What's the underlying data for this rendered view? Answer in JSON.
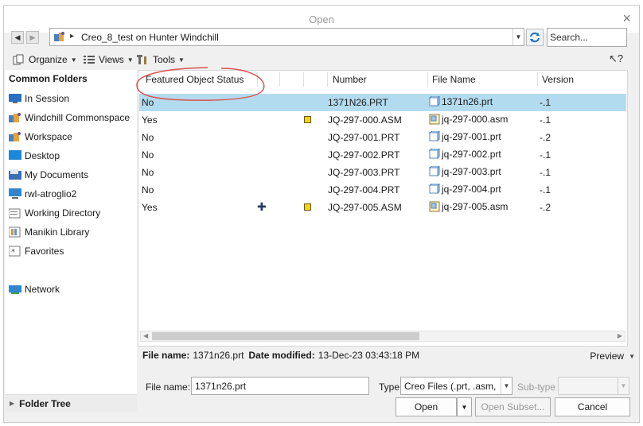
{
  "window": {
    "title": "Open",
    "close_glyph": "×"
  },
  "nav": {
    "back_icon": "back-arrow-icon",
    "forward_icon": "forward-arrow-icon"
  },
  "address": {
    "arrow": "▸",
    "path": "Creo_8_test on Hunter Windchill"
  },
  "search": {
    "placeholder": "Search..."
  },
  "toolbar": {
    "organize": "Organize",
    "views": "Views",
    "tools": "Tools",
    "help_glyph": "?"
  },
  "sidebar": {
    "header": "Common Folders",
    "items": [
      {
        "label": "In Session",
        "icon": "session-icon"
      },
      {
        "label": "Windchill Commonspace",
        "icon": "commonspace-icon"
      },
      {
        "label": "Workspace",
        "icon": "workspace-icon"
      },
      {
        "label": "Desktop",
        "icon": "desktop-icon"
      },
      {
        "label": "My Documents",
        "icon": "documents-icon"
      },
      {
        "label": "rwl-atroglio2",
        "icon": "computer-icon"
      },
      {
        "label": "Working Directory",
        "icon": "working-directory-icon"
      },
      {
        "label": "Manikin Library",
        "icon": "library-icon"
      },
      {
        "label": "Favorites",
        "icon": "favorites-icon"
      },
      {
        "label": "Network",
        "icon": "network-icon"
      }
    ],
    "tree_label": "Folder Tree"
  },
  "file_list": {
    "columns": [
      "Featured Object Status",
      "Number",
      "File Name",
      "Version"
    ],
    "rows": [
      {
        "status": "No",
        "number": "1371N26.PRT",
        "file_name": "1371n26.prt",
        "version": "-.1",
        "selected": true
      },
      {
        "status": "Yes",
        "number": "JQ-297-000.ASM",
        "file_name": "jq-297-000.asm",
        "version": "-.1"
      },
      {
        "status": "No",
        "number": "JQ-297-001.PRT",
        "file_name": "jq-297-001.prt",
        "version": "-.2"
      },
      {
        "status": "No",
        "number": "JQ-297-002.PRT",
        "file_name": "jq-297-002.prt",
        "version": "-.1"
      },
      {
        "status": "No",
        "number": "JQ-297-003.PRT",
        "file_name": "jq-297-003.prt",
        "version": "-.1"
      },
      {
        "status": "No",
        "number": "JQ-297-004.PRT",
        "file_name": "jq-297-004.prt",
        "version": "-.1"
      },
      {
        "status": "Yes",
        "number": "JQ-297-005.ASM",
        "file_name": "jq-297-005.asm",
        "version": "-.2"
      }
    ]
  },
  "info": {
    "file_name_label": "File name:",
    "file_name_value": "1371n26.prt",
    "date_label": "Date modified:",
    "date_value": "13-Dec-23 03:43:18 PM",
    "preview_label": "Preview"
  },
  "bottom": {
    "file_name_label": "File name:",
    "file_name_value": "1371n26.prt",
    "type_label": "Type",
    "type_value": "Creo Files (.prt, .asm,",
    "subtype_label": "Sub-type",
    "subtype_value": "",
    "open_label": "Open",
    "open_subset_label": "Open Subset...",
    "cancel_label": "Cancel"
  },
  "colors": {
    "selection": "#b3dbef",
    "annotation": "#d9534f",
    "accent": "#1e6fb8"
  }
}
